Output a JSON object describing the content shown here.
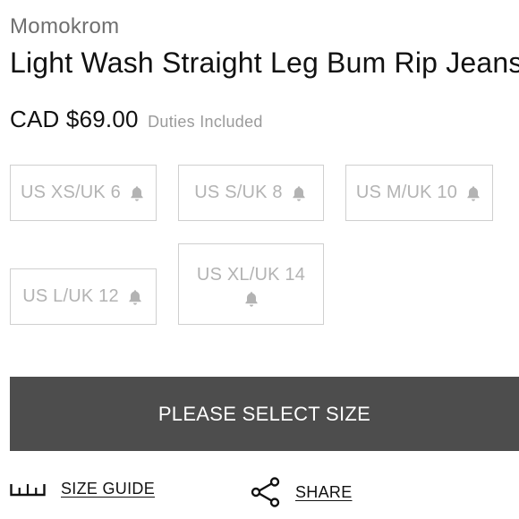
{
  "product": {
    "brand": "Momokrom",
    "title": "Light Wash Straight Leg Bum Rip Jeans",
    "price": "CAD $69.00",
    "duties_note": "Duties Included"
  },
  "sizes": [
    {
      "label": "US XS/UK 6",
      "icon": "bell-icon",
      "available": false
    },
    {
      "label": "US S/UK 8",
      "icon": "bell-icon",
      "available": false
    },
    {
      "label": "US M/UK 10",
      "icon": "bell-icon",
      "available": false
    },
    {
      "label": "US L/UK 12",
      "icon": "bell-icon",
      "available": false
    },
    {
      "label": "US XL/UK 14",
      "icon": "bell-icon",
      "available": false
    }
  ],
  "cta": {
    "label": "PLEASE SELECT SIZE"
  },
  "links": {
    "size_guide": {
      "label": "SIZE GUIDE",
      "icon": "ruler-icon"
    },
    "share": {
      "label": "SHARE",
      "icon": "share-icon"
    }
  },
  "colors": {
    "cta_background": "#4d4d4d",
    "size_text": "#b3b3b3",
    "size_border": "#cfcfcf",
    "brand_text": "#6f6f6f"
  }
}
